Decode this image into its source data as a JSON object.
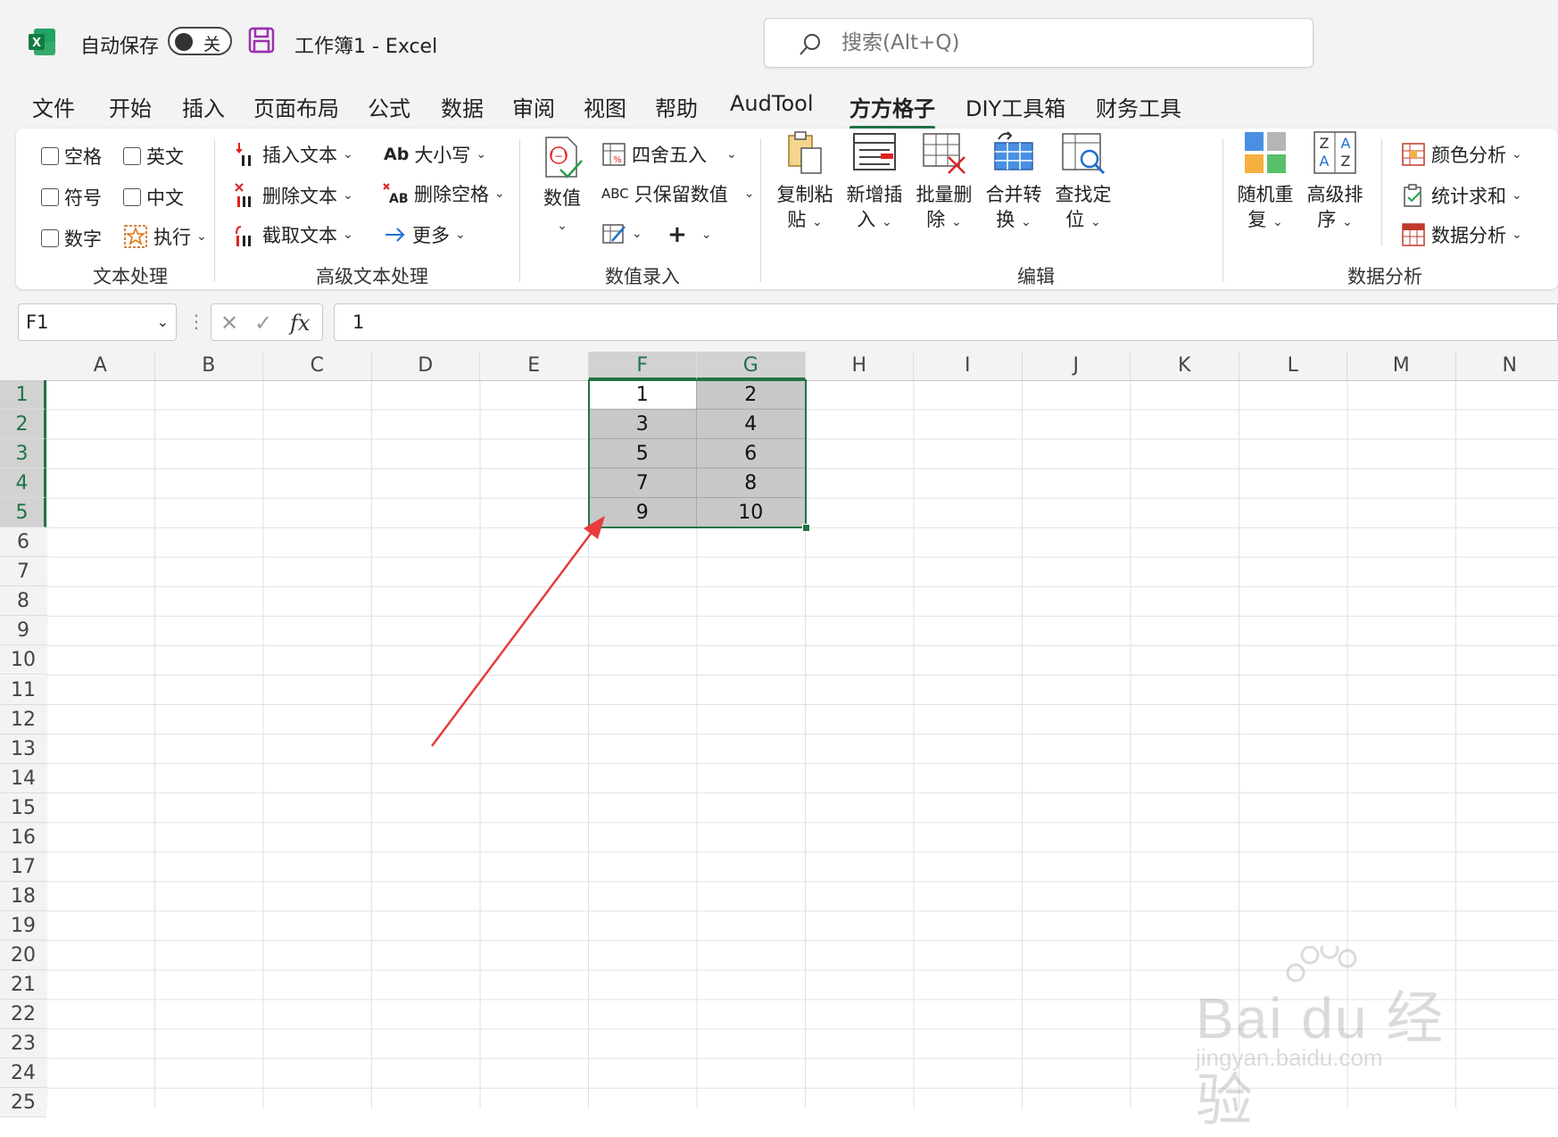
{
  "titlebar": {
    "autosave_label": "自动保存",
    "autosave_state": "关",
    "doc_title": "工作簿1  -  Excel",
    "search_placeholder": "搜索(Alt+Q)"
  },
  "menu": {
    "tabs": [
      "文件",
      "开始",
      "插入",
      "页面布局",
      "公式",
      "数据",
      "审阅",
      "视图",
      "帮助",
      "AudTool",
      "方方格子",
      "DIY工具箱",
      "财务工具"
    ],
    "active_index": 10
  },
  "ribbon": {
    "text_group": {
      "label": "文本处理",
      "checkboxes": [
        "空格",
        "英文",
        "符号",
        "中文",
        "数字"
      ],
      "execute": "执行"
    },
    "adv_text_group": {
      "label": "高级文本处理",
      "insert_text": "插入文本",
      "delete_text": "删除文本",
      "cut_text": "截取文本",
      "case": "大小写",
      "delete_space": "删除空格",
      "more": "更多"
    },
    "value_group": {
      "label": "数值录入",
      "value_btn": "数值",
      "round": "四舍五入",
      "keep_value": "只保留数值",
      "plus": "+"
    },
    "edit_group": {
      "label": "编辑",
      "copy_paste": [
        "复制粘",
        "贴"
      ],
      "new_insert": [
        "新增插",
        "入"
      ],
      "batch_delete": [
        "批量删",
        "除"
      ],
      "merge_convert": [
        "合并转",
        "换"
      ],
      "find_locate": [
        "查找定",
        "位"
      ]
    },
    "analysis_group": {
      "label": "数据分析",
      "random_repeat": [
        "随机重",
        "复"
      ],
      "advanced_sort": [
        "高级排",
        "序"
      ],
      "color_analysis": "颜色分析",
      "stat_sum": "统计求和",
      "data_analysis": "数据分析"
    }
  },
  "formula_bar": {
    "name_box": "F1",
    "fx": "fx",
    "value": "1"
  },
  "sheet": {
    "columns": [
      "A",
      "B",
      "C",
      "D",
      "E",
      "F",
      "G",
      "H",
      "I",
      "J",
      "K",
      "L",
      "M",
      "N"
    ],
    "rows": [
      "1",
      "2",
      "3",
      "4",
      "5",
      "6",
      "7",
      "8",
      "9",
      "10",
      "11",
      "12",
      "13",
      "14",
      "15",
      "16",
      "17",
      "18",
      "19",
      "20",
      "21",
      "22",
      "23",
      "24",
      "25"
    ],
    "selected_columns": [
      "F",
      "G"
    ],
    "selected_rows": [
      "1",
      "2",
      "3",
      "4",
      "5"
    ],
    "data": [
      {
        "F": "1",
        "G": "2"
      },
      {
        "F": "3",
        "G": "4"
      },
      {
        "F": "5",
        "G": "6"
      },
      {
        "F": "7",
        "G": "8"
      },
      {
        "F": "9",
        "G": "10"
      }
    ]
  },
  "colors": {
    "accent": "#217346",
    "selection_fill": "#c8c8c8",
    "annotation_arrow": "#e83b3b"
  },
  "watermark": {
    "brand": "Bai du 经验",
    "url": "jingyan.baidu.com"
  }
}
